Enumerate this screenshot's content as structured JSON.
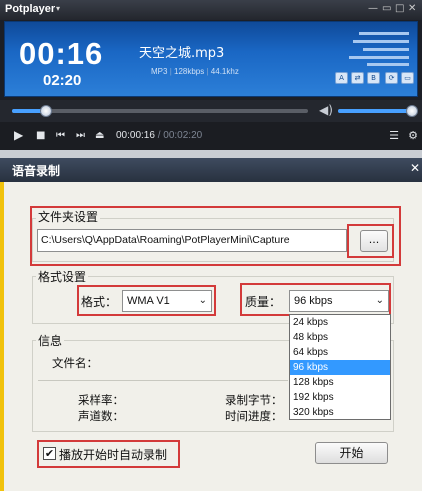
{
  "player": {
    "app_name": "Potplayer",
    "app_menu_arrow": "▾",
    "window_buttons": [
      "—",
      "▭",
      "□",
      "✕"
    ],
    "current_time_big": "00:16",
    "total_time_big": "02:20",
    "file_name": "天空之城.mp3",
    "file_format": "MP3",
    "bitrate": "128kbps",
    "sample_rate": "44.1khz",
    "mini_buttons": [
      "A",
      "⇄",
      "B",
      "⟳",
      "▭"
    ],
    "seek_progress": 0.114,
    "volume_level": 0.98,
    "volume_icon": "speaker-icon",
    "time_current": "00:00:16",
    "time_separator": "/",
    "time_total": "00:02:20"
  },
  "dialog": {
    "title": "语音录制",
    "close": "✕",
    "folder_group_label": "文件夹设置",
    "folder_path": "C:\\Users\\Q\\AppData\\Roaming\\PotPlayerMini\\Capture",
    "browse_label": "...",
    "format_group_label": "格式设置",
    "format_label": "格式：",
    "format_value": "WMA V1",
    "quality_label": "质量：",
    "quality_value": "96 kbps",
    "quality_options": [
      "24 kbps",
      "48 kbps",
      "64 kbps",
      "96 kbps",
      "128 kbps",
      "192 kbps",
      "320 kbps"
    ],
    "quality_selected_index": 3,
    "info_group_label": "信息",
    "filename_label": "文件名：",
    "sample_rate_label": "采样率：",
    "channels_label": "声道数：",
    "bytes_label": "录制字节：",
    "progress_label": "时间进度：",
    "auto_record_checked": "✔",
    "auto_record_label": "播放开始时自动录制",
    "start_label": "开始"
  },
  "colors": {
    "accent_blue": "#1a67c4",
    "highlight_red": "#d33a3a",
    "dialog_border_yellow": "#f1c20c",
    "selection_blue": "#3399ff"
  }
}
